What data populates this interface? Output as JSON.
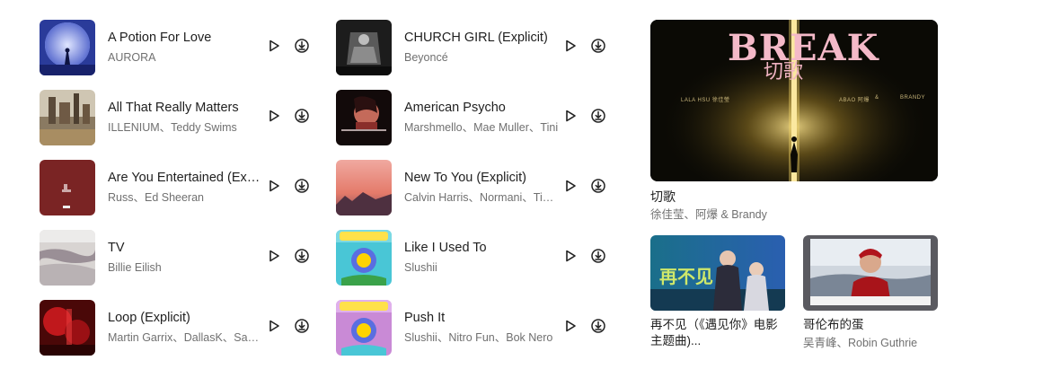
{
  "tracks_col1": [
    {
      "title": "A Potion For Love",
      "artist": "AURORA"
    },
    {
      "title": "All That Really Matters",
      "artist": "ILLENIUM、Teddy Swims"
    },
    {
      "title": "Are You Entertained (Explicit)",
      "artist": "Russ、Ed Sheeran"
    },
    {
      "title": "TV",
      "artist": "Billie Eilish"
    },
    {
      "title": "Loop (Explicit)",
      "artist": "Martin Garrix、DallasK、Sasha Alex Sloan"
    }
  ],
  "tracks_col2": [
    {
      "title": "CHURCH GIRL (Explicit)",
      "artist": "Beyoncé"
    },
    {
      "title": "American Psycho",
      "artist": "Marshmello、Mae Muller、Tini"
    },
    {
      "title": "New To You (Explicit)",
      "artist": "Calvin Harris、Normani、Tinashe"
    },
    {
      "title": "Like I Used To",
      "artist": "Slushii"
    },
    {
      "title": "Push It",
      "artist": "Slushii、Nitro Fun、Bok Nero"
    }
  ],
  "featured": {
    "cover_title": "BREAK",
    "cover_subtitle": "切歌",
    "cover_credits": [
      "LALA HSU 徐佳瑩",
      "ABAO 阿爆",
      "&",
      "BRANDY"
    ],
    "title": "切歌",
    "artist": "徐佳莹、阿爆 & Brandy"
  },
  "mini_cards": [
    {
      "title": "再不见（《遇见你》电影主题曲)...",
      "artist": "",
      "cover_text": "再不见"
    },
    {
      "title": "哥伦布的蛋",
      "artist": "吴青峰、Robin Guthrie",
      "cover_text": ""
    }
  ],
  "colors": {
    "icon": "#222222",
    "title": "#1f1f1f",
    "artist": "#707070"
  },
  "icons": {
    "play": "play-icon",
    "download": "download-icon"
  }
}
